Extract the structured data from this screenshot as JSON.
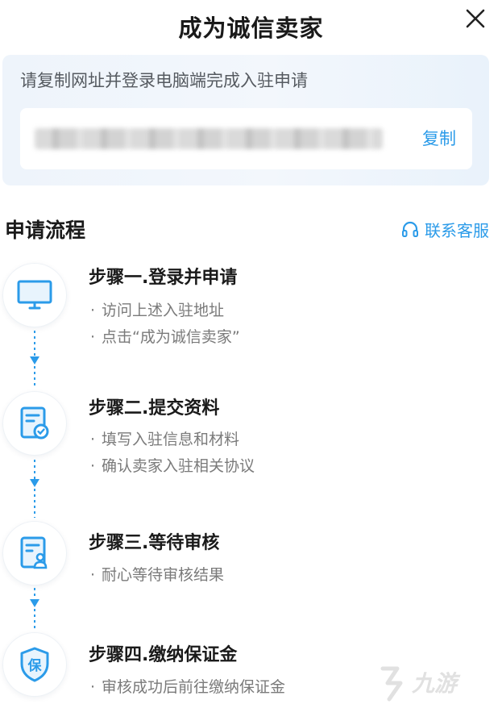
{
  "header": {
    "title": "成为诚信卖家",
    "close_icon": "close-icon"
  },
  "banner": {
    "instruction": "请复制网址并登录电脑端完成入驻申请",
    "copy_label": "复制"
  },
  "process": {
    "title": "申请流程",
    "contact_label": "联系客服",
    "steps": [
      {
        "title": "步骤一.登录并申请",
        "icon": "monitor-icon",
        "items": [
          "访问上述入驻地址",
          "点击“成为诚信卖家”"
        ]
      },
      {
        "title": "步骤二.提交资料",
        "icon": "document-check-icon",
        "items": [
          "填写入驻信息和材料",
          "确认卖家入驻相关协议"
        ]
      },
      {
        "title": "步骤三.等待审核",
        "icon": "document-user-icon",
        "items": [
          "耐心等待审核结果"
        ]
      },
      {
        "title": "步骤四.缴纳保证金",
        "icon": "shield-bao-icon",
        "items": [
          "审核成功后前往缴纳保证金"
        ]
      }
    ]
  },
  "watermark": {
    "text": "九游"
  },
  "colors": {
    "accent": "#2b9be9",
    "connector": "#2b9be9"
  }
}
